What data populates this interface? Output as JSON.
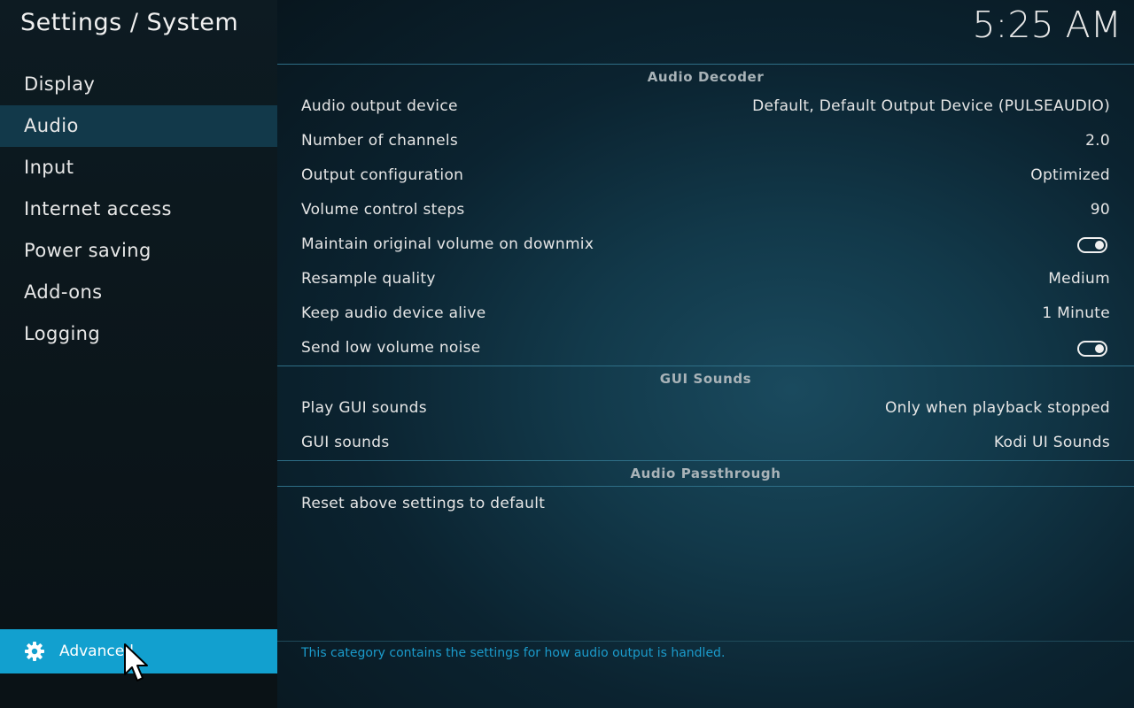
{
  "header": {
    "title": "Settings / System",
    "clock": "5:25 AM"
  },
  "sidebar": {
    "items": [
      {
        "label": "Display"
      },
      {
        "label": "Audio"
      },
      {
        "label": "Input"
      },
      {
        "label": "Internet access"
      },
      {
        "label": "Power saving"
      },
      {
        "label": "Add-ons"
      },
      {
        "label": "Logging"
      }
    ],
    "active_item": "Audio",
    "level_button": {
      "label": "Advanced",
      "icon": "gear-icon"
    }
  },
  "sections": {
    "audio_decoder": {
      "title": "Audio Decoder",
      "rows": [
        {
          "label": "Audio output device",
          "value": "Default, Default Output Device (PULSEAUDIO)"
        },
        {
          "label": "Number of channels",
          "value": "2.0"
        },
        {
          "label": "Output configuration",
          "value": "Optimized"
        },
        {
          "label": "Volume control steps",
          "value": "90"
        },
        {
          "label": "Maintain original volume on downmix",
          "toggle": true
        },
        {
          "label": "Resample quality",
          "value": "Medium"
        },
        {
          "label": "Keep audio device alive",
          "value": "1 Minute"
        },
        {
          "label": "Send low volume noise",
          "toggle": true
        }
      ]
    },
    "gui_sounds": {
      "title": "GUI Sounds",
      "rows": [
        {
          "label": "Play GUI sounds",
          "value": "Only when playback stopped"
        },
        {
          "label": "GUI sounds",
          "value": "Kodi UI Sounds"
        }
      ]
    },
    "audio_passthrough": {
      "title": "Audio Passthrough",
      "rows": [
        {
          "label": "Reset above settings to default"
        }
      ]
    }
  },
  "footer": {
    "description": "This category contains the settings for how audio output is handled."
  },
  "colors": {
    "accent": "#12a0cf",
    "active_item_bg": "#12394a",
    "footer_text": "#1b9bcb"
  }
}
